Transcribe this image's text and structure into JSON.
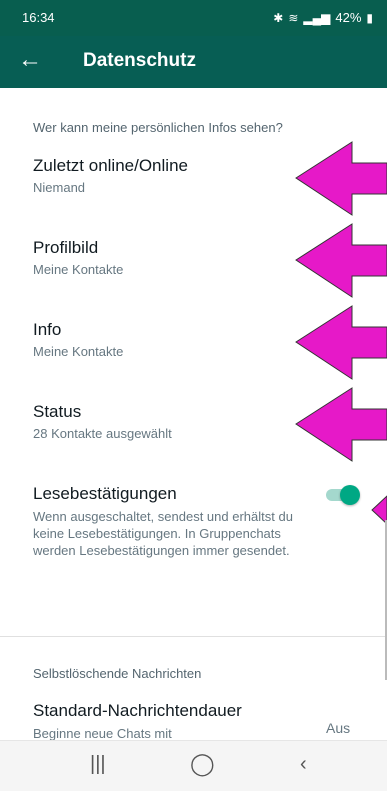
{
  "status_bar": {
    "time": "16:34",
    "battery": "42%",
    "icons": [
      "bluetooth-icon",
      "wifi-icon",
      "signal-icon",
      "battery-icon"
    ]
  },
  "app_bar": {
    "back_icon": "arrow-left-icon",
    "title": "Datenschutz"
  },
  "privacy": {
    "section_title": "Wer kann meine persönlichen Infos sehen?",
    "items": [
      {
        "title": "Zuletzt online/Online",
        "value": "Niemand"
      },
      {
        "title": "Profilbild",
        "value": "Meine Kontakte"
      },
      {
        "title": "Info",
        "value": "Meine Kontakte"
      },
      {
        "title": "Status",
        "value": "28 Kontakte ausgewählt"
      }
    ],
    "read_receipts": {
      "title": "Lesebestätigungen",
      "description": "Wenn ausgeschaltet, sendest und erhältst du keine Lesebestätigungen. In Gruppenchats werden Lesebestätigungen immer gesendet.",
      "enabled": true
    }
  },
  "disappearing": {
    "section_title": "Selbstlöschende Nachrichten",
    "default_timer": {
      "title": "Standard-Nachrichtendauer",
      "description": "Beginne neue Chats mit selbstlöschenden Nachrichten, die",
      "value": "Aus"
    }
  },
  "annotation": {
    "arrow_color": "#e619c8"
  },
  "nav_bar": [
    "recent-apps-icon",
    "home-icon",
    "back-icon"
  ],
  "colors": {
    "header": "#075e54",
    "accent": "#00a884"
  }
}
